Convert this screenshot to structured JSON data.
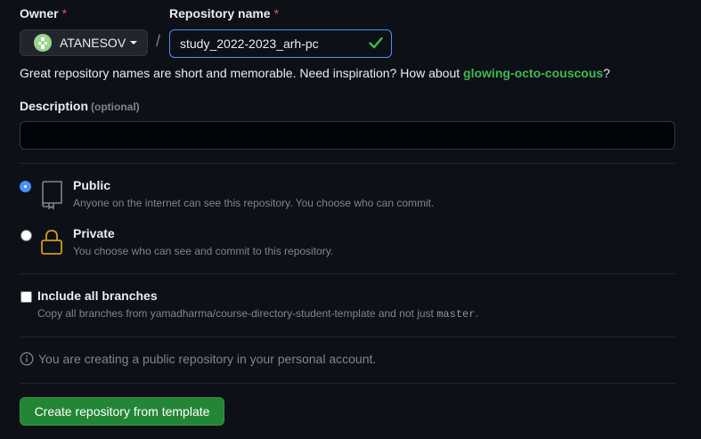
{
  "owner": {
    "label": "Owner",
    "required_mark": "*",
    "selected": "ATANESOV",
    "avatar_icon": "identicon-avatar"
  },
  "repo": {
    "label": "Repository name",
    "required_mark": "*",
    "value": "study_2022-2023_arh-pc",
    "valid_icon": "check-icon",
    "separator": "/"
  },
  "hint": {
    "prefix": "Great repository names are short and memorable. Need inspiration? How about ",
    "suggestion": "glowing-octo-couscous",
    "suffix": "?"
  },
  "description": {
    "label": "Description",
    "optional": "(optional)",
    "value": ""
  },
  "visibility": {
    "public": {
      "title": "Public",
      "desc": "Anyone on the internet can see this repository. You choose who can commit.",
      "checked": true,
      "icon": "repo-icon"
    },
    "private": {
      "title": "Private",
      "desc": "You choose who can see and commit to this repository.",
      "checked": false,
      "icon": "lock-icon"
    }
  },
  "branches": {
    "title": "Include all branches",
    "desc_prefix": "Copy all branches from yamadharma/course-directory-student-template and not just ",
    "desc_code": "master",
    "desc_suffix": ".",
    "checked": false
  },
  "info": {
    "text": "You are creating a public repository in your personal account.",
    "icon": "info-icon"
  },
  "submit": {
    "label": "Create repository from template"
  },
  "colors": {
    "accent": "#4493f8",
    "success": "#3fb950",
    "button": "#238636",
    "required": "#f85149",
    "lock": "#d29922"
  }
}
